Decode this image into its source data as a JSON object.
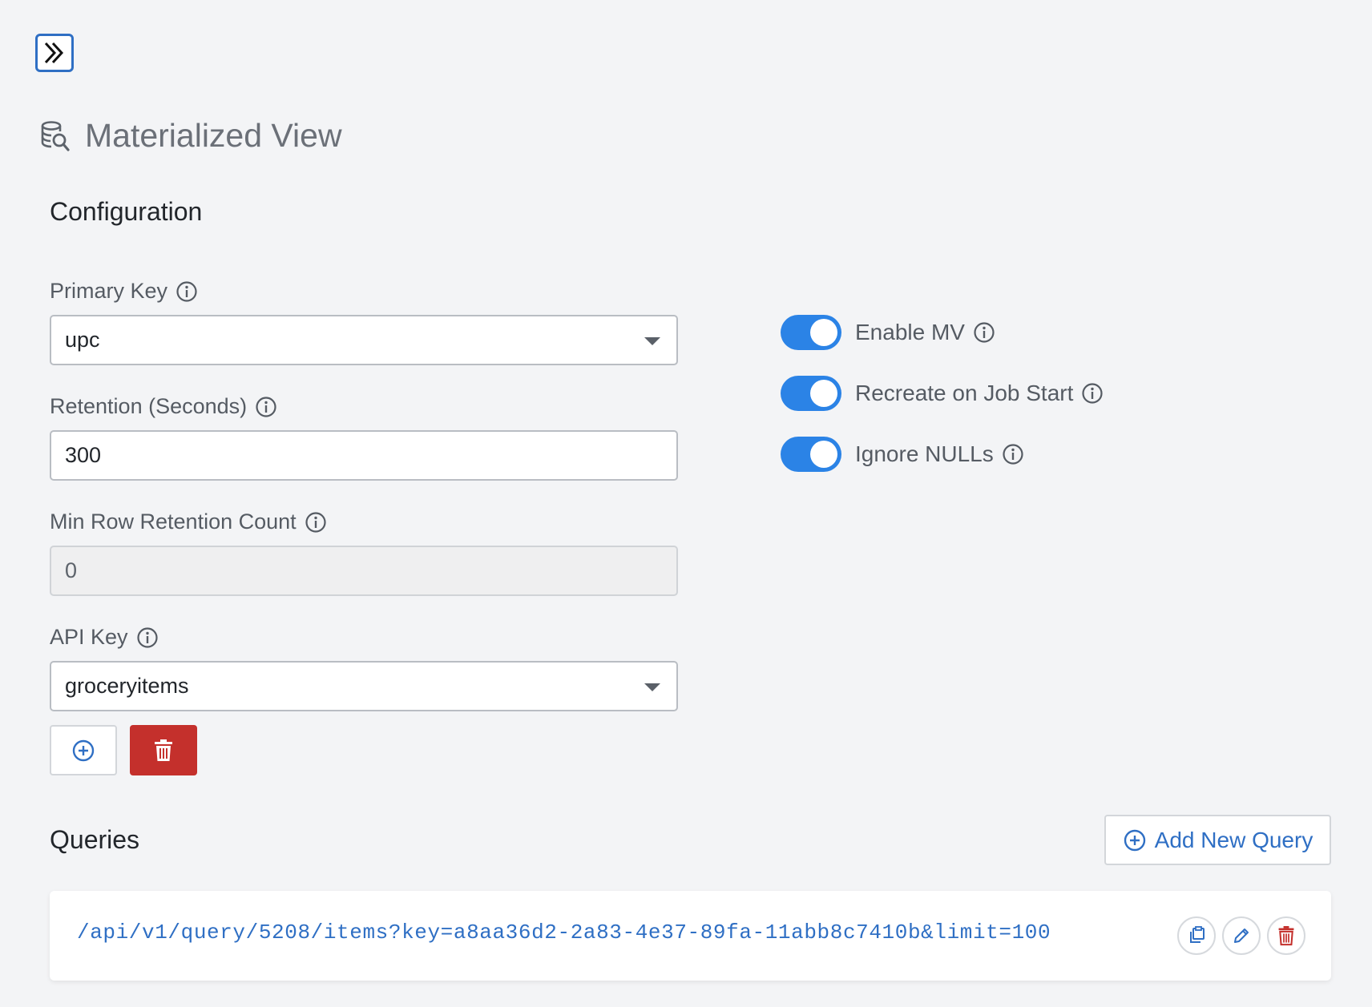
{
  "header": {
    "collapse_icon": "double-chevron-right-icon",
    "title": "Materialized View",
    "title_icon": "database-search-icon"
  },
  "configuration": {
    "heading": "Configuration",
    "primary_key": {
      "label": "Primary Key",
      "value": "upc"
    },
    "retention": {
      "label": "Retention (Seconds)",
      "value": "300"
    },
    "min_row_retention": {
      "label": "Min Row Retention Count",
      "value": "0"
    },
    "api_key": {
      "label": "API Key",
      "value": "groceryitems"
    },
    "toggles": [
      {
        "label": "Enable MV",
        "on": true
      },
      {
        "label": "Recreate on Job Start",
        "on": true
      },
      {
        "label": "Ignore NULLs",
        "on": true
      }
    ]
  },
  "queries": {
    "heading": "Queries",
    "add_button_label": "Add New Query",
    "items": [
      {
        "url": "/api/v1/query/5208/items?key=a8aa36d2-2a83-4e37-89fa-11abb8c7410b&limit=100"
      }
    ]
  },
  "colors": {
    "accent": "#2f6fc4",
    "toggle_on": "#2b83e6",
    "danger": "#c4302c",
    "background": "#f3f4f6"
  }
}
